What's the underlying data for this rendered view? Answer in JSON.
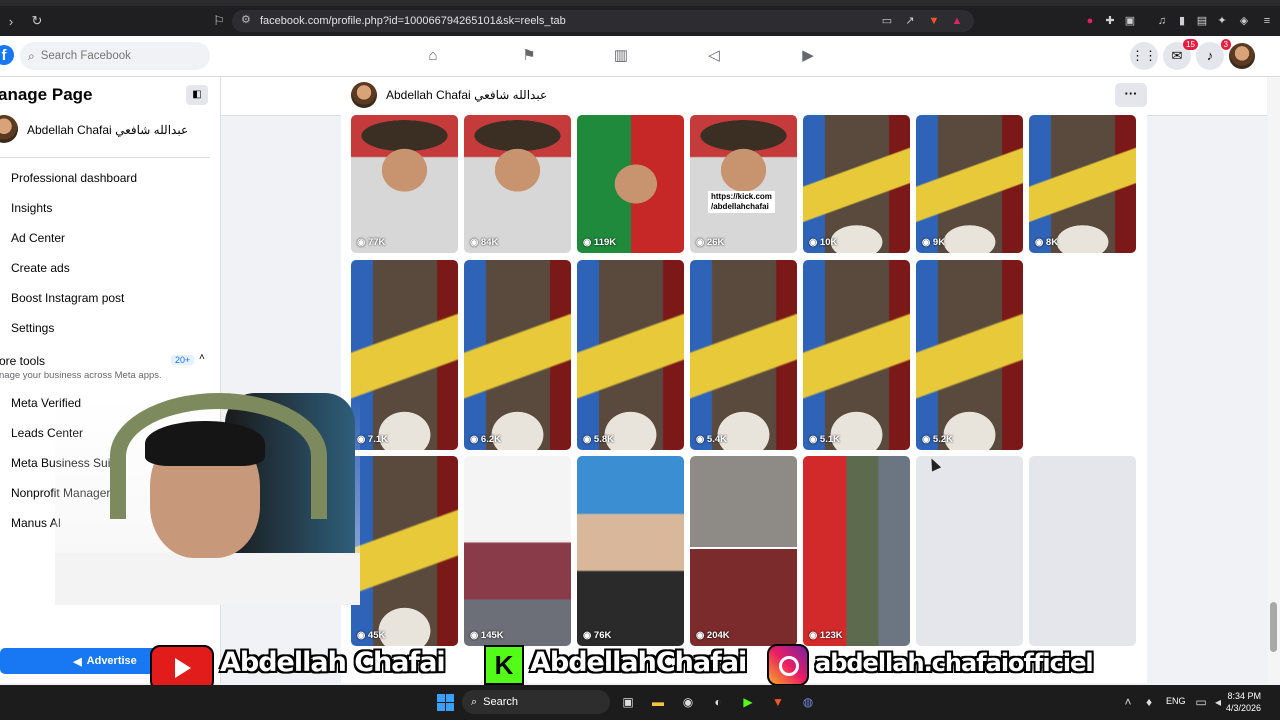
{
  "browser": {
    "url": "facebook.com/profile.php?id=100066794265101&sk=reels_tab"
  },
  "fb_nav": {
    "search_placeholder": "Search Facebook",
    "messenger_badge": "15",
    "notifications_badge": "3"
  },
  "sidebar": {
    "title": "anage Page",
    "page_name": "Abdellah Chafai عبدالله شافعي",
    "items": [
      {
        "label": "Professional dashboard"
      },
      {
        "label": "Insights"
      },
      {
        "label": "Ad Center"
      },
      {
        "label": "Create ads"
      },
      {
        "label": "Boost Instagram post"
      },
      {
        "label": "Settings"
      }
    ],
    "more_tools_title": "ore tools",
    "more_tools_sub": "nage your business across Meta apps.",
    "more_tools_badge": "20+",
    "tools": [
      {
        "label": "Meta Verified"
      },
      {
        "label": "Leads Center"
      },
      {
        "label": "Meta Business Suite"
      },
      {
        "label": "Nonprofit Manager"
      },
      {
        "label": "Manus AI"
      }
    ],
    "advertise_label": "Advertise"
  },
  "profile": {
    "name": "Abdellah Chafai عبدالله شافعي"
  },
  "reels": [
    {
      "views": "77K",
      "img": "img-hat"
    },
    {
      "views": "84K",
      "img": "img-hat"
    },
    {
      "views": "119K",
      "img": "img-flags"
    },
    {
      "views": "26K",
      "img": "img-hat",
      "overlay": "https://kick.com\n/abdellahchafai"
    },
    {
      "views": "10K",
      "img": "img-donkey"
    },
    {
      "views": "9K",
      "img": "img-donkey"
    },
    {
      "views": "8K",
      "img": "img-donkey"
    },
    {
      "views": "7.1K",
      "img": "img-donkey"
    },
    {
      "views": "6.2K",
      "img": "img-donkey"
    },
    {
      "views": "5.8K",
      "img": "img-donkey"
    },
    {
      "views": "5.4K",
      "img": "img-donkey"
    },
    {
      "views": "5.1K",
      "img": "img-donkey"
    },
    {
      "views": "5.2K",
      "img": "img-donkey"
    },
    {
      "views": "45K",
      "img": "img-donkey"
    },
    {
      "views": "145K",
      "img": "img-hospital"
    },
    {
      "views": "76K",
      "img": "img-podcast"
    },
    {
      "views": "204K",
      "img": "img-split"
    },
    {
      "views": "123K",
      "img": "img-street"
    }
  ],
  "banner": {
    "youtube": "Abdellah Chafai",
    "kick": "AbdellahChafai",
    "instagram": "abdellah.chafaiofficiel"
  },
  "taskbar": {
    "search_label": "Search",
    "lang": "ENG",
    "time": "8:34 PM",
    "date": "4/3/2026"
  }
}
